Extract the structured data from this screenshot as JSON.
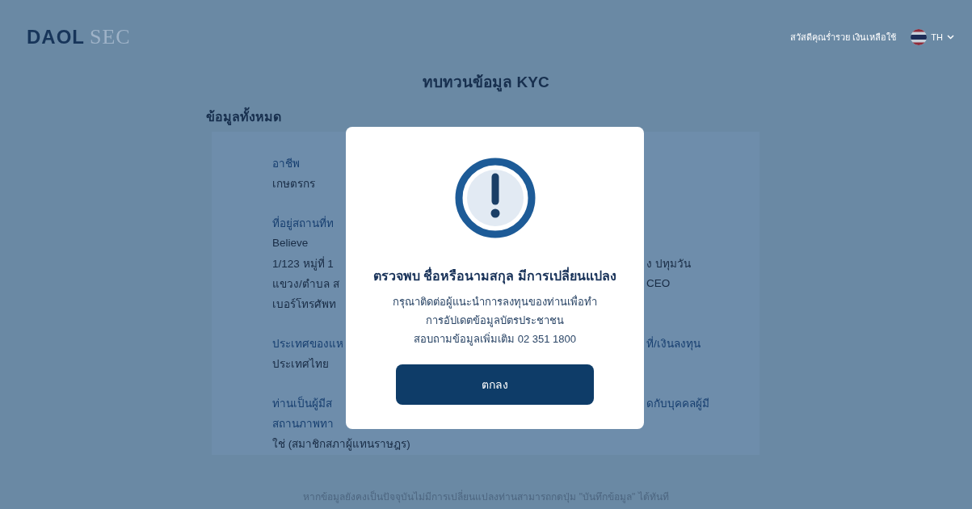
{
  "header": {
    "logo_main": "DAOL",
    "logo_sub": "SEC",
    "greeting": "สวัสดีคุณร่ำรวย เงินเหลือใช้",
    "language": "TH"
  },
  "page_title": "ทบทวนข้อมูล KYC",
  "section_title": "ข้อมูลทั้งหมด",
  "groups": [
    {
      "lines": [
        {
          "kind": "label",
          "text": "อาชีพ"
        },
        {
          "kind": "value",
          "text": "เกษตรกร"
        }
      ]
    },
    {
      "lines": [
        {
          "kind": "label",
          "text": "ที่อยู่สถานที่ท"
        },
        {
          "kind": "value",
          "text": "Believe"
        },
        {
          "kind": "value",
          "text": "1/123 หมู่ที่ 1",
          "right": "ง ปทุมวัน"
        },
        {
          "kind": "value",
          "text": "แขวง/ตำบล ส",
          "right": "CEO"
        },
        {
          "kind": "value",
          "text": "เบอร์โทรศัพท"
        }
      ]
    },
    {
      "lines": [
        {
          "kind": "label",
          "text": "ประเทศของแห",
          "right": "ที่/เงินลงทุน"
        },
        {
          "kind": "value",
          "text": "ประเทศไทย"
        }
      ]
    },
    {
      "lines": [
        {
          "kind": "label",
          "text": "ท่านเป็นผู้มีส",
          "right": "ดกับบุคคลผู้มี"
        },
        {
          "kind": "label",
          "text": "สถานภาพทา"
        },
        {
          "kind": "value",
          "text": "ใช่ (สมาชิกสภาผู้แทนราษฎร)"
        }
      ]
    }
  ],
  "footer_note": "หากข้อมูลยังคงเป็นปัจจุบันไม่มีการเปลี่ยนแปลงท่านสามารถกดปุ่ม \"บันทึกข้อมูล\" ได้ทันที",
  "dialog": {
    "title": "ตรวจพบ ชื่อหรือนามสกุล มีการเปลี่ยนแปลง",
    "message": [
      "กรุณาติดต่อผู้แนะนำการลงทุนของท่านเพื่อทำ",
      "การอัปเดตข้อมูลบัตรประชาชน",
      "สอบถามข้อมูลเพิ่มเติม 02 351 1800"
    ],
    "button": "ตกลง"
  }
}
